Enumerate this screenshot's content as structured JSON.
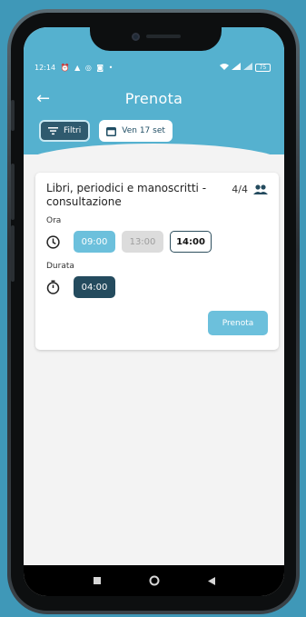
{
  "status": {
    "time": "12:14",
    "left_icons": [
      "alarm-icon",
      "warning-icon",
      "whatsapp-icon",
      "instagram-icon"
    ],
    "dot": "•",
    "right_icons": [
      "wifi-icon",
      "signal-icon",
      "signal-icon"
    ],
    "battery": "75"
  },
  "appbar": {
    "title": "Prenota",
    "back_icon": "arrow-left-icon"
  },
  "filters": {
    "filter_label": "Filtri",
    "date_label": "Ven 17 set"
  },
  "card": {
    "title": "Libri, periodici e manoscritti - consultazione",
    "capacity": "4/4",
    "ora_label": "Ora",
    "times": [
      {
        "label": "09:00",
        "state": "selected"
      },
      {
        "label": "13:00",
        "state": "disabled"
      },
      {
        "label": "14:00",
        "state": "outlined"
      }
    ],
    "durata_label": "Durata",
    "duration": "04:00",
    "book_label": "Prenota"
  },
  "colors": {
    "header": "#55b1cf",
    "accent": "#6cc0dc",
    "dark": "#244b5e"
  }
}
